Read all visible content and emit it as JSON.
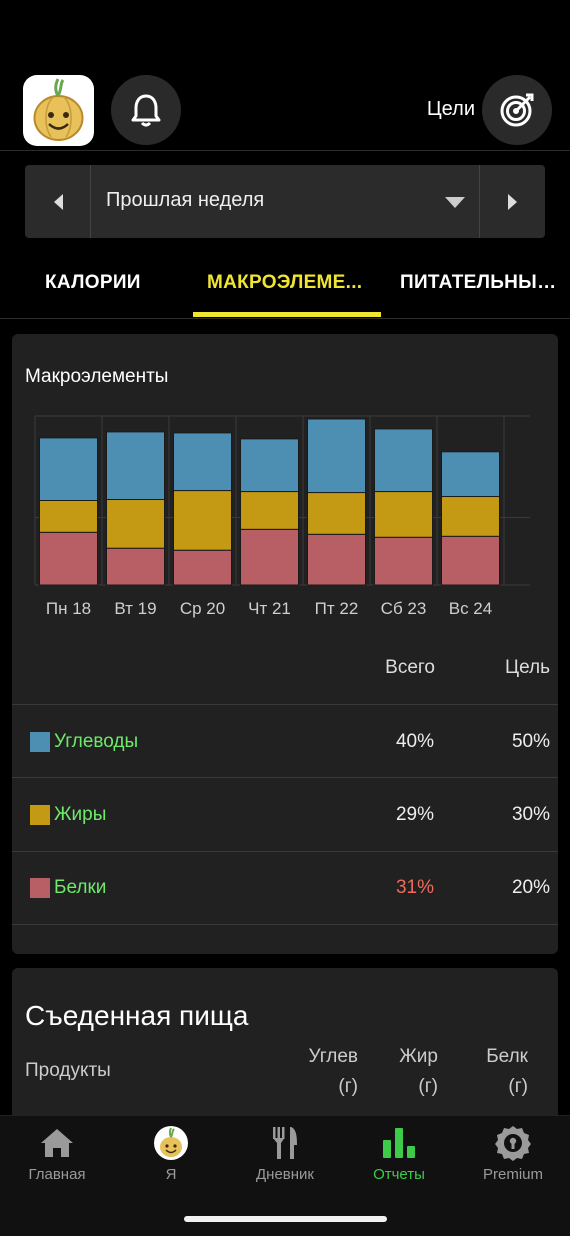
{
  "header": {
    "goals_label": "Цели"
  },
  "date_selector": {
    "label": "Прошлая неделя"
  },
  "tabs": [
    {
      "label": "КАЛОРИИ"
    },
    {
      "label": "МАКРОЭЛЕМЕ..."
    },
    {
      "label": "ПИТАТЕЛЬНЫЕ..."
    }
  ],
  "macro_card": {
    "title": "Макроэлементы",
    "col_total": "Всего",
    "col_goal": "Цель",
    "rows": [
      {
        "name": "Углеводы",
        "color": "#4d8eb3",
        "total": "40%",
        "goal": "50%",
        "total_color": "#eeeeee"
      },
      {
        "name": "Жиры",
        "color": "#c49a14",
        "total": "29%",
        "goal": "30%",
        "total_color": "#eeeeee"
      },
      {
        "name": "Белки",
        "color": "#b85f65",
        "total": "31%",
        "goal": "20%",
        "total_color": "#f16a5a"
      }
    ]
  },
  "chart_data": {
    "type": "bar",
    "stacked": true,
    "categories": [
      "Пн 18",
      "Вт 19",
      "Ср 20",
      "Чт 21",
      "Пт 22",
      "Сб 23",
      "Вс 24"
    ],
    "series": [
      {
        "name": "Белки",
        "color": "#b85f65",
        "values": [
          53,
          37,
          35,
          56,
          51,
          48,
          49
        ]
      },
      {
        "name": "Жиры",
        "color": "#c49a14",
        "values": [
          32,
          49,
          60,
          38,
          42,
          46,
          40
        ]
      },
      {
        "name": "Углеводы",
        "color": "#4d8eb3",
        "values": [
          63,
          68,
          58,
          53,
          74,
          63,
          45
        ]
      }
    ],
    "ylim": [
      0,
      170
    ],
    "grid": true
  },
  "eaten_card": {
    "title": "Съеденная пища",
    "col_products": "Продукты",
    "col_carbs_1": "Углев",
    "col_carbs_2": "(г)",
    "col_fat_1": "Жир",
    "col_fat_2": "(г)",
    "col_protein_1": "Белк",
    "col_protein_2": "(г)"
  },
  "bottom_nav": [
    {
      "label": "Главная",
      "icon": "home-icon"
    },
    {
      "label": "Я",
      "icon": "avatar-icon"
    },
    {
      "label": "Дневник",
      "icon": "fork-knife-icon"
    },
    {
      "label": "Отчеты",
      "icon": "bar-chart-icon"
    },
    {
      "label": "Premium",
      "icon": "premium-badge-icon"
    }
  ],
  "colors": {
    "accent_tab": "#f0e530",
    "active_nav": "#3ecb4a",
    "macro_label": "#6ee96a"
  }
}
